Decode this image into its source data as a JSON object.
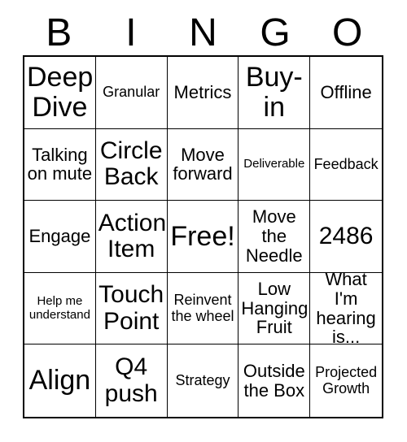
{
  "card": {
    "header_letters": [
      "B",
      "I",
      "N",
      "G",
      "O"
    ],
    "rows": [
      [
        {
          "text": "Deep Dive",
          "size": "xl"
        },
        {
          "text": "Granular",
          "size": "sm"
        },
        {
          "text": "Metrics",
          "size": "md"
        },
        {
          "text": "Buy-in",
          "size": "xl"
        },
        {
          "text": "Offline",
          "size": "md"
        }
      ],
      [
        {
          "text": "Talking on mute",
          "size": "md"
        },
        {
          "text": "Circle Back",
          "size": "lg"
        },
        {
          "text": "Move forward",
          "size": "md"
        },
        {
          "text": "Deliverable",
          "size": "xs"
        },
        {
          "text": "Feedback",
          "size": "sm"
        }
      ],
      [
        {
          "text": "Engage",
          "size": "md"
        },
        {
          "text": "Action Item",
          "size": "lg"
        },
        {
          "text": "Free!",
          "size": "xl"
        },
        {
          "text": "Move the Needle",
          "size": "md"
        },
        {
          "text": "2486",
          "size": "lg"
        }
      ],
      [
        {
          "text": "Help me understand",
          "size": "xs"
        },
        {
          "text": "Touch Point",
          "size": "lg"
        },
        {
          "text": "Reinvent the wheel",
          "size": "sm"
        },
        {
          "text": "Low Hanging Fruit",
          "size": "md"
        },
        {
          "text": "What I'm hearing is...",
          "size": "md"
        }
      ],
      [
        {
          "text": "Align",
          "size": "xl"
        },
        {
          "text": "Q4 push",
          "size": "lg"
        },
        {
          "text": "Strategy",
          "size": "sm"
        },
        {
          "text": "Outside the Box",
          "size": "md"
        },
        {
          "text": "Projected Growth",
          "size": "sm"
        }
      ]
    ]
  },
  "colors": {
    "background": "#ffffff",
    "text": "#000000",
    "grid_line": "#000000"
  }
}
